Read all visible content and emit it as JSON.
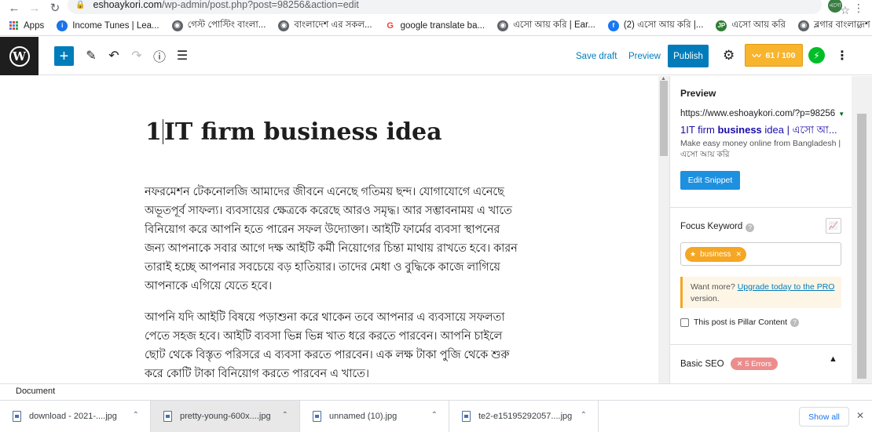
{
  "browser": {
    "url_host": "eshoaykori.com",
    "url_path": "/wp-admin/post.php?post=98256&action=edit",
    "profile_initials": "এসো"
  },
  "bookmarks": [
    {
      "label": "Apps",
      "icon": "apps-grid-icon",
      "color": "#4285f4"
    },
    {
      "label": "Income Tunes | Lea...",
      "icon": "info-icon",
      "color": "#1a73e8"
    },
    {
      "label": "গেস্ট পোস্টিং বাংলা...",
      "icon": "globe-icon",
      "color": "#5f6368"
    },
    {
      "label": "বাংলাদেশ এর সকল...",
      "icon": "globe-icon",
      "color": "#5f6368"
    },
    {
      "label": "google translate ba...",
      "icon": "google-icon",
      "color": "#ea4335"
    },
    {
      "label": "এসো আয় করি | Ear...",
      "icon": "globe-icon",
      "color": "#5f6368"
    },
    {
      "label": "(2) এসো আয় করি |...",
      "icon": "facebook-icon",
      "color": "#1877f2"
    },
    {
      "label": "এসো আয় করি",
      "icon": "jp-icon",
      "color": "#2e7d32",
      "badge": "JP"
    },
    {
      "label": "ব্লগার বাংলাদেশ",
      "icon": "globe-icon",
      "color": "#5f6368"
    }
  ],
  "toolbar": {
    "save_draft": "Save draft",
    "preview": "Preview",
    "publish": "Publish",
    "score": "61 / 100"
  },
  "post": {
    "title_prefix": "1",
    "title_rest": "IT firm business idea",
    "paragraphs": [
      "নফরমেশন টেকনোলজি আমাদের জীবনে এনেছে গতিময় ছন্দ। যোগাযোগে এনেছে অভূতপূর্ব সাফল্য। ব্যবসায়ের ক্ষেত্রকে করেছে আরও সমৃদ্ধ। আর সম্ভাবনাময় এ খাতে বিনিয়োগ করে আপনি হতে পারেন সফল উদ্যোক্তা। আইটি ফার্মের ব্যবসা স্থাপনের জন্য আপনাকে সবার আগে দক্ষ আইটি কর্মী নিয়োগের চিন্তা মাথায় রাখতে হবে। কারন তারাই হচ্ছে আপনার সবচেয়ে বড় হাতিয়ার। তাদের মেধা ও বুদ্ধিকে কাজে লাগিয়ে আপনাকে এগিয়ে যেতে হবে।",
      "আপনি যদি আইটি বিষয়ে পড়াশুনা করে থাকেন তবে আপনার এ ব্যবসায়ে সফলতা পেতে সহজ হবে। আইটি ব্যবসা ভিন্ন ভিন্ন খাত ধরে করতে পারবেন। আপনি চাইলে ছোট থেকে বিস্তৃত পরিসরে এ ব্যবসা করতে পারবেন। এক লক্ষ টাকা পুজি থেকে শুরু করে কোটি টাকা বিনিয়োগ করতে পারবেন এ খাতে।"
    ]
  },
  "sidebar": {
    "preview_heading": "Preview",
    "snippet_url": "https://www.eshoaykori.com/?p=98256",
    "snippet_title_pre": "1IT firm ",
    "snippet_title_bold": "business",
    "snippet_title_post": " idea | এসো আ...",
    "snippet_desc": "Make easy money online from Bangladesh | এসো আয় করি",
    "edit_snippet": "Edit Snippet",
    "focus_keyword_label": "Focus Keyword",
    "keyword_chip": "business",
    "upgrade_text": "Want more?",
    "upgrade_link": "Upgrade today to the PRO",
    "upgrade_suffix": "version.",
    "pillar_label": "This post is Pillar Content",
    "basic_seo_label": "Basic SEO",
    "errors_badge": "5 Errors"
  },
  "footer": {
    "breadcrumb": "Document"
  },
  "downloads": {
    "items": [
      "download - 2021-....jpg",
      "pretty-young-600x....jpg",
      "unnamed (10).jpg",
      "te2-e15195292057....jpg"
    ],
    "show_all": "Show all"
  },
  "colors": {
    "wp_blue": "#007cba",
    "rank_math_orange": "#f9b42e",
    "error_red": "#ec8d8d",
    "bolt_green": "#00be28"
  }
}
